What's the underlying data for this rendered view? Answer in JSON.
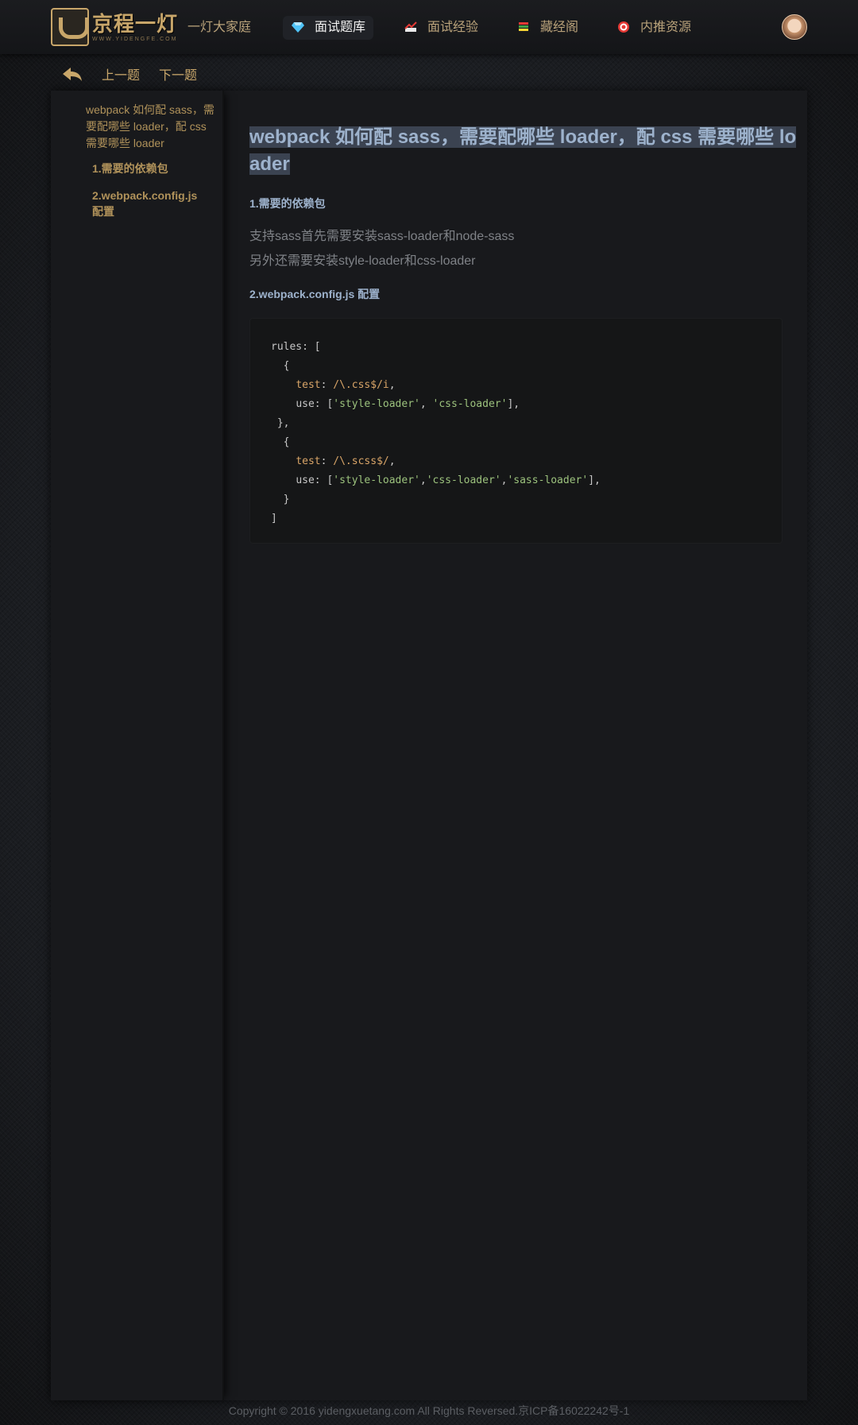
{
  "header": {
    "logo_text": "京程一灯",
    "logo_sub": "WWW.YIDENGFE.COM",
    "nav": [
      {
        "label": "一灯大家庭",
        "icon": "none",
        "active": false
      },
      {
        "label": "面试题库",
        "icon": "diamond-icon",
        "active": true
      },
      {
        "label": "面试经验",
        "icon": "chart-icon",
        "active": false
      },
      {
        "label": "藏经阁",
        "icon": "books-icon",
        "active": false
      },
      {
        "label": "内推资源",
        "icon": "target-icon",
        "active": false
      }
    ]
  },
  "subnav": {
    "prev_label": "上一题",
    "next_label": "下一题"
  },
  "toc": {
    "title": "webpack 如何配 sass，需要配哪些 loader，配 css 需要哪些 loader",
    "items": [
      "1.需要的依赖包",
      "2.webpack.config.js 配置"
    ]
  },
  "article": {
    "title": "webpack 如何配 sass，需要配哪些 loader，配 css 需要哪些 loader",
    "section1_heading": "1.需要的依赖包",
    "section1_lines": [
      "支持sass首先需要安装sass-loader和node-sass",
      "另外还需要安装style-loader和css-loader"
    ],
    "section2_heading": "2.webpack.config.js 配置",
    "code": {
      "l1": "rules: [",
      "l2": "  {",
      "l3_key": "test",
      "l3_val": "/\\.css$/i",
      "l4_key": "use",
      "l4_s1": "'style-loader'",
      "l4_s2": "'css-loader'",
      "l5": " },",
      "l6": "  {",
      "l7_key": "test",
      "l7_val": "/\\.scss$/",
      "l8_key": "use",
      "l8_s1": "'style-loader'",
      "l8_s2": "'css-loader'",
      "l8_s3": "'sass-loader'",
      "l9": "  }",
      "l10": "]"
    }
  },
  "footer": {
    "text": "Copyright © 2016 yidengxuetang.com All Rights Reversed.京ICP备16022242号-1"
  },
  "colors": {
    "accent_gold": "#c8a66a",
    "title_blue": "#9db2cc",
    "title_highlight": "#3b4351",
    "string_green": "#9cc27d"
  }
}
